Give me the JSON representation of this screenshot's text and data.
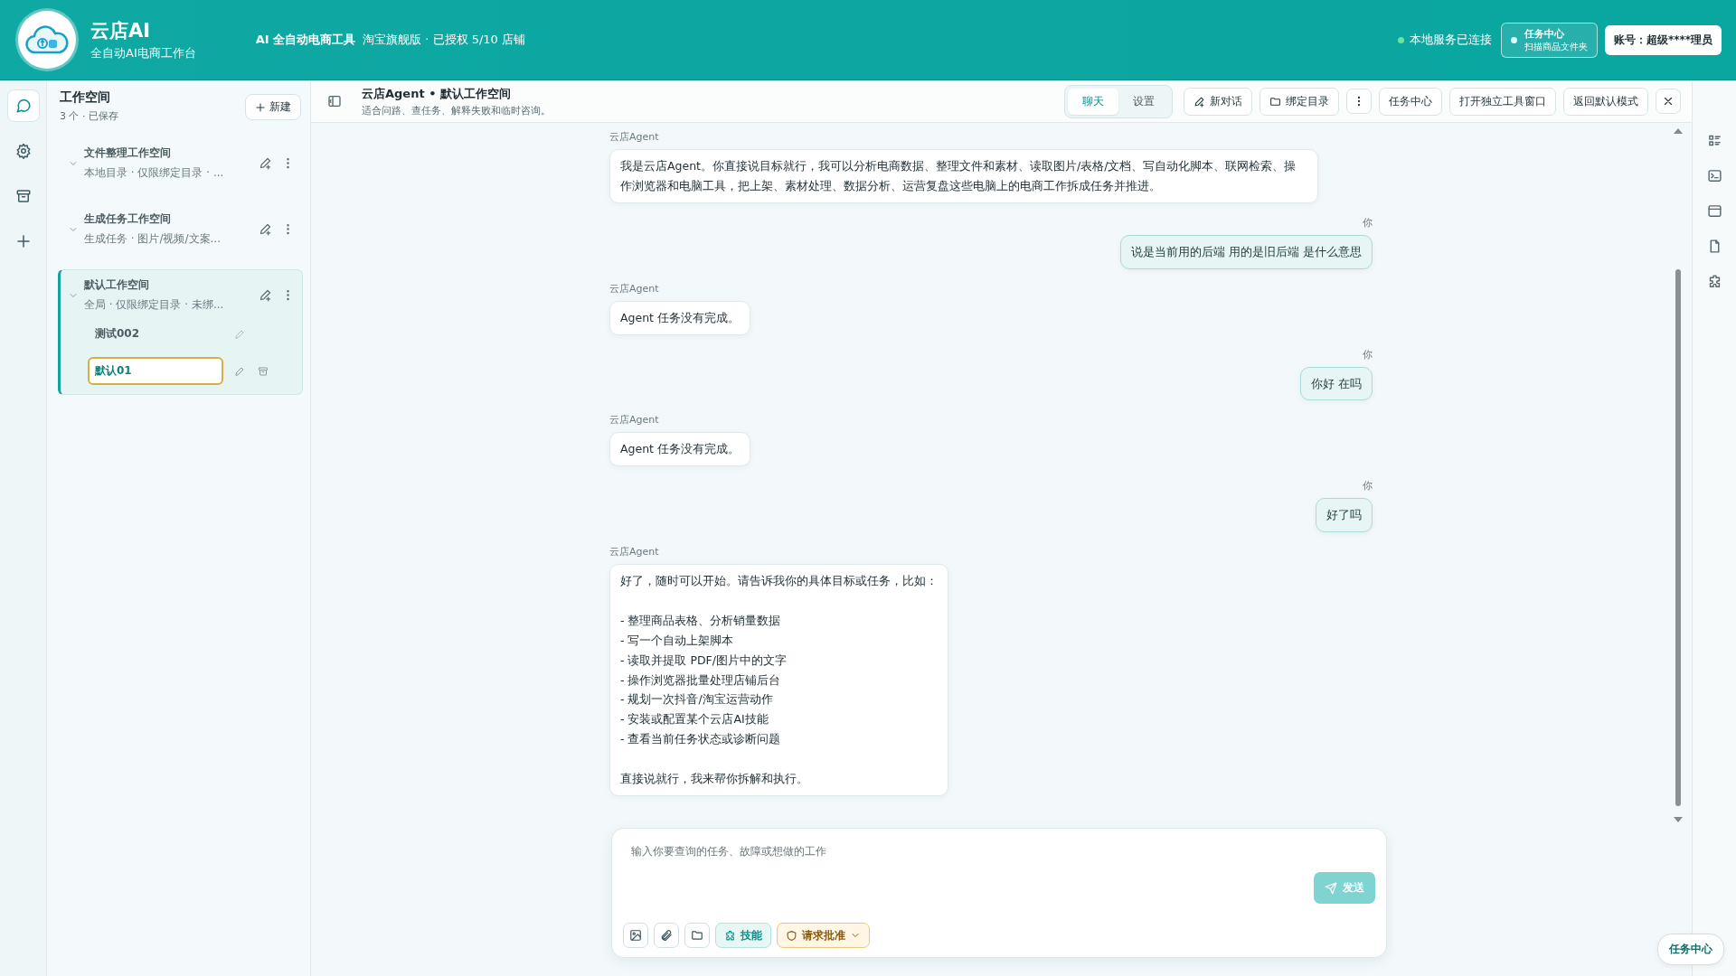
{
  "header": {
    "app_name": "云店AI",
    "app_subtitle": "全自动AI电商工作台",
    "product": "AI 全自动电商工具",
    "license": "淘宝旗舰版 · 已授权 5/10 店铺",
    "service_status": "本地服务已连接",
    "task_center": {
      "title": "任务中心",
      "subtitle": "扫描商品文件夹"
    },
    "account": "账号：超级****理员"
  },
  "rail": [
    {
      "kind": "chat",
      "selected": true
    },
    {
      "kind": "settings",
      "selected": false
    },
    {
      "kind": "archive",
      "selected": false
    },
    {
      "kind": "add",
      "selected": false
    }
  ],
  "sidebar": {
    "title": "工作空间",
    "subtitle": "3 个 · 已保存",
    "new_button": "新建",
    "workspaces": [
      {
        "name": "文件整理工作空间",
        "desc": "本地目录 · 仅限绑定目录 · ...",
        "selected": false
      },
      {
        "name": "生成任务工作空间",
        "desc": "生成任务 · 图片/视频/文案...",
        "selected": false
      },
      {
        "name": "默认工作空间",
        "desc": "全局 · 仅限绑定目录 · 未绑...",
        "selected": true,
        "children": [
          {
            "name": "测试002",
            "selected": false
          },
          {
            "name": "默认01",
            "selected": true
          }
        ]
      }
    ]
  },
  "toolbar": {
    "title": "云店Agent • 默认工作空间",
    "subtitle": "适合问路、查任务、解释失败和临时咨询。",
    "tabs": [
      {
        "label": "聊天",
        "selected": true
      },
      {
        "label": "设置",
        "selected": false
      }
    ],
    "buttons": [
      {
        "kind": "new",
        "label": "新对话"
      },
      {
        "kind": "folder",
        "label": "绑定目录"
      },
      {
        "kind": "more"
      },
      {
        "kind": "plain",
        "label": "任务中心"
      },
      {
        "kind": "plain",
        "label": "打开独立工具窗口"
      },
      {
        "kind": "plain",
        "label": "返回默认模式"
      },
      {
        "kind": "close"
      }
    ]
  },
  "messages": [
    {
      "kind": "agent",
      "sender": "云店Agent",
      "text": "我是云店Agent。你直接说目标就行，我可以分析电商数据、整理文件和素材、读取图片/表格/文档、写自动化脚本、联网检索、操作浏览器和电脑工具，把上架、素材处理、数据分析、运营复盘这些电脑上的电商工作拆成任务并推进。"
    },
    {
      "kind": "user",
      "sender": "你",
      "text": "说是当前用的后端 用的是旧后端 是什么意思"
    },
    {
      "kind": "agent",
      "sender": "云店Agent",
      "text": "Agent 任务没有完成。"
    },
    {
      "kind": "user",
      "sender": "你",
      "text": "你好 在吗"
    },
    {
      "kind": "agent",
      "sender": "云店Agent",
      "text": "Agent 任务没有完成。"
    },
    {
      "kind": "user",
      "sender": "你",
      "text": "好了吗"
    },
    {
      "kind": "agent",
      "sender": "云店Agent",
      "paragraphs": [
        [
          "好了，随时可以开始。请告诉我你的具体目标或任务，比如："
        ],
        [
          "- 整理商品表格、分析销量数据",
          "- 写一个自动上架脚本",
          "- 读取并提取 PDF/图片中的文字",
          "- 操作浏览器批量处理店铺后台",
          "- 规划一次抖音/淘宝运营动作",
          "- 安装或配置某个云店AI技能",
          "- 查看当前任务状态或诊断问题"
        ],
        [
          "直接说就行，我来帮你拆解和执行。"
        ]
      ]
    }
  ],
  "composer": {
    "placeholder": "输入你要查询的任务、故障或想做的工作",
    "send": "发送",
    "tools": [
      {
        "kind": "image"
      },
      {
        "kind": "attach"
      },
      {
        "kind": "folder"
      },
      {
        "kind": "skill",
        "label": "技能"
      },
      {
        "kind": "approval",
        "label": "请求批准"
      }
    ]
  },
  "right_rail": [
    {
      "kind": "list"
    },
    {
      "kind": "terminal"
    },
    {
      "kind": "window"
    },
    {
      "kind": "file"
    },
    {
      "kind": "puzzle"
    }
  ],
  "floating_button": "任务中心"
}
